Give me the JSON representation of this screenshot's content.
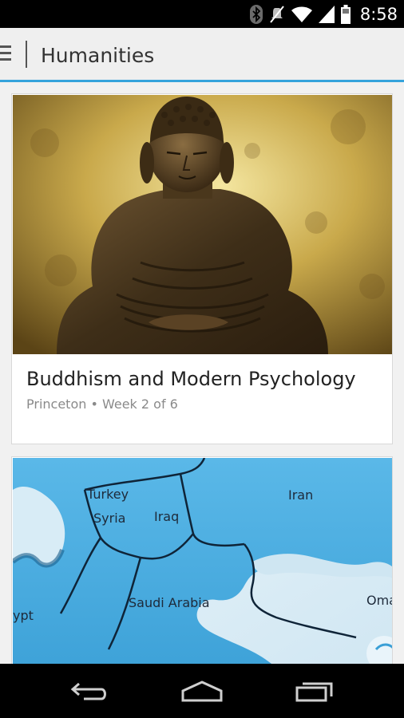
{
  "status_bar": {
    "time": "8:58",
    "icons": [
      "bluetooth-icon",
      "mute-icon",
      "wifi-icon",
      "signal-icon",
      "battery-icon"
    ]
  },
  "action_bar": {
    "title": "Humanities",
    "menu_icon": "hamburger-menu-icon",
    "accent_color": "#35a3dc"
  },
  "courses": [
    {
      "title": "Buddhism and Modern Psychology",
      "meta": "Princeton • Week 2 of 6",
      "image": "buddha-statue-image"
    },
    {
      "image": "middle-east-map-image",
      "map_labels": {
        "turkey": "Turkey",
        "syria": "Syria",
        "iraq": "Iraq",
        "iran": "Iran",
        "saudi_arabia": "Saudi Arabia",
        "egypt": "ypt",
        "oman": "Oma"
      }
    }
  ],
  "nav_bar": {
    "icons": [
      "back-icon",
      "home-icon",
      "recent-apps-icon"
    ]
  }
}
